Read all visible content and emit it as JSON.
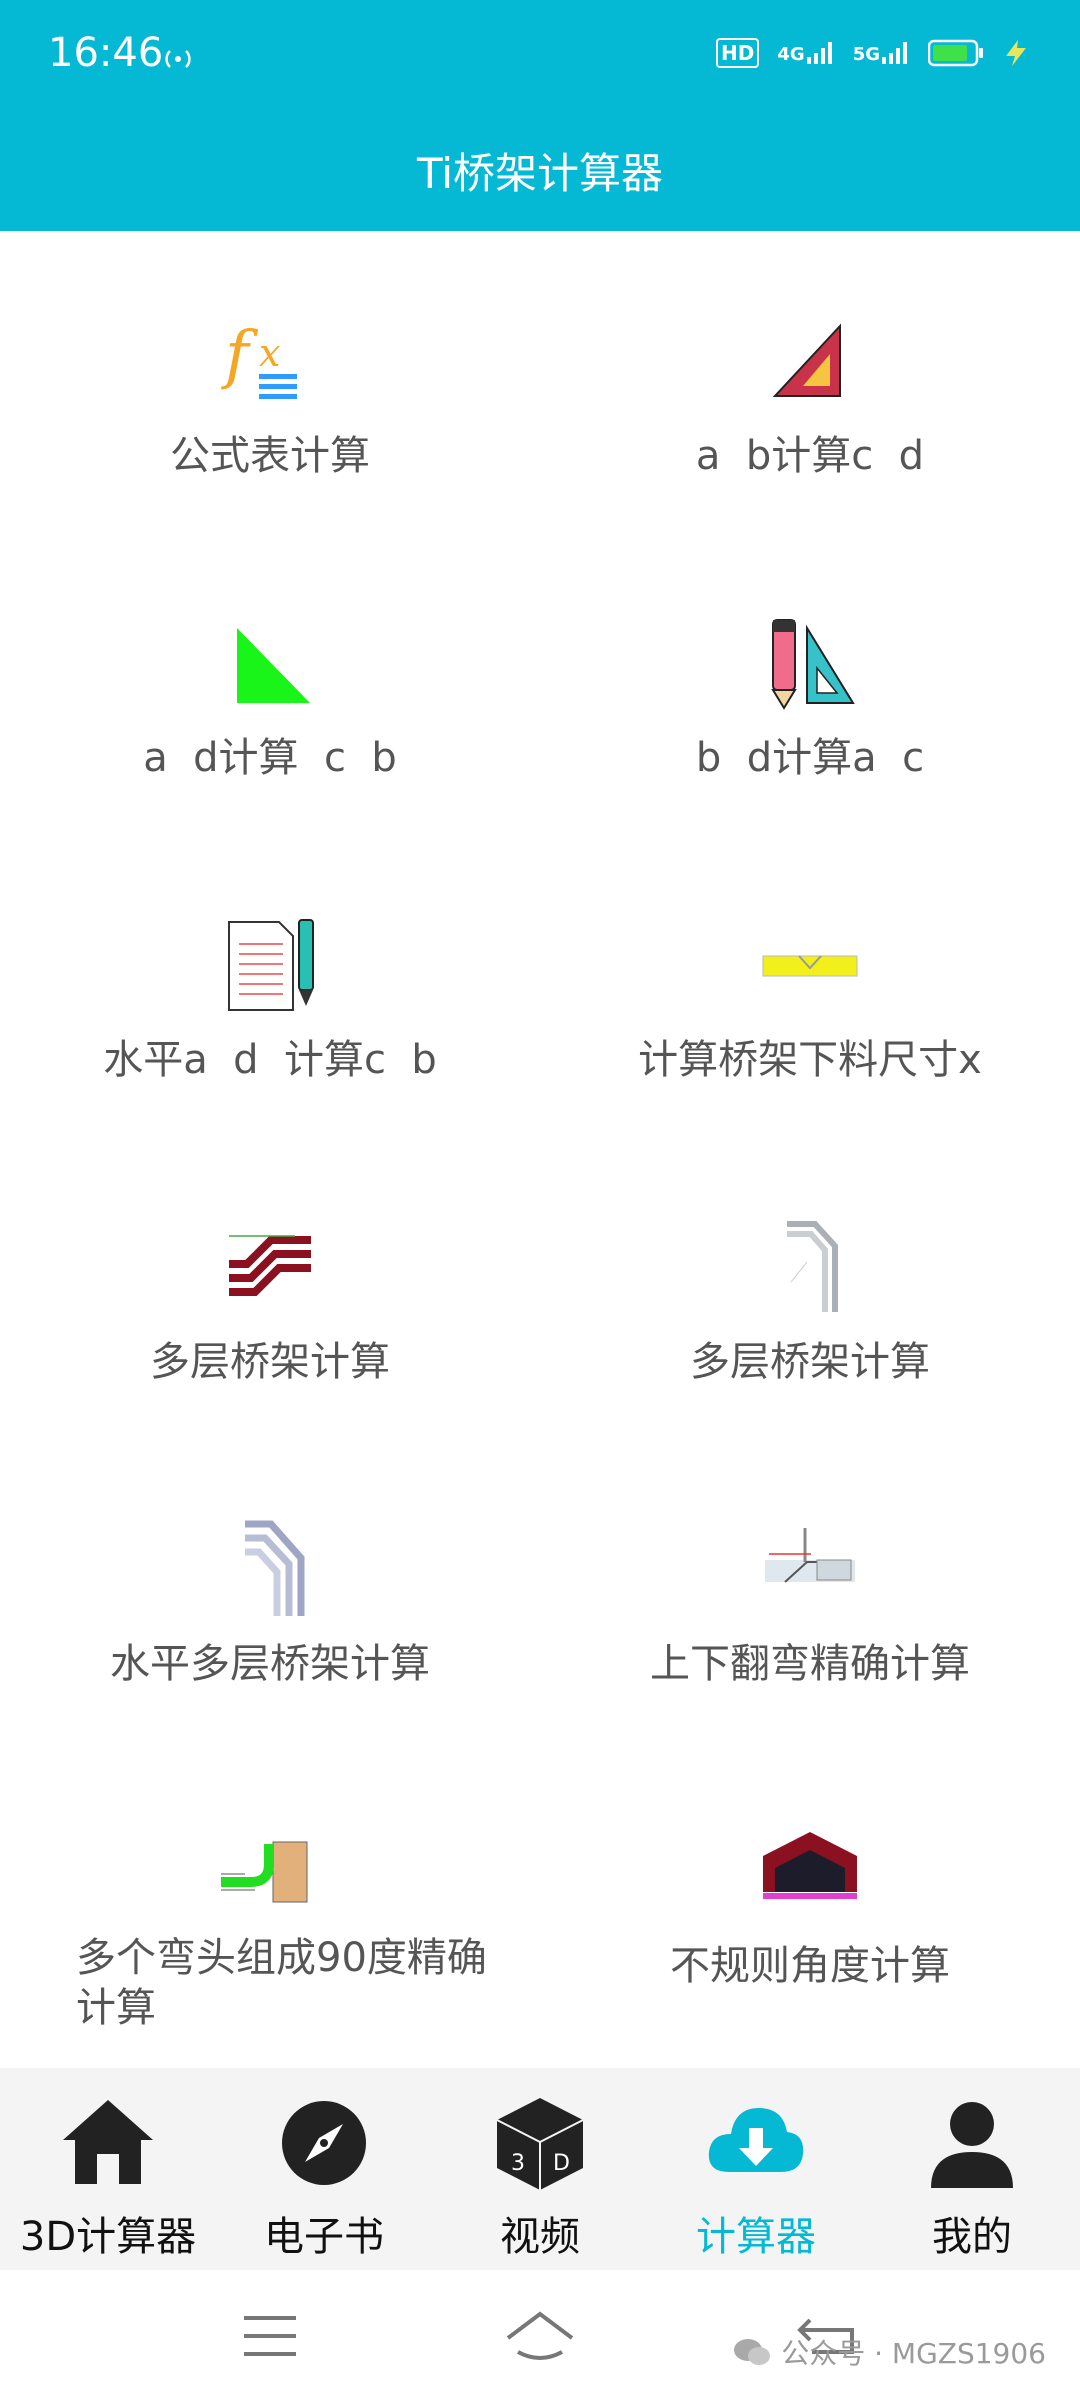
{
  "status": {
    "time": "16:46",
    "hd_label": "HD",
    "net1": "4G",
    "net2": "5G"
  },
  "app": {
    "title": "Ti桥架计算器"
  },
  "tiles": [
    {
      "label": "公式表计算",
      "icon": "formula-icon"
    },
    {
      "label": "a  b计算c  d",
      "icon": "set-square-icon"
    },
    {
      "label": "a  d计算  c  b",
      "icon": "green-triangle-icon"
    },
    {
      "label": "b  d计算a  c",
      "icon": "pencil-ruler-icon"
    },
    {
      "label": "水平a  d  计算c  b",
      "icon": "document-pen-icon"
    },
    {
      "label": "计算桥架下料尺寸x",
      "icon": "cable-tray-icon"
    },
    {
      "label": "多层桥架计算",
      "icon": "multilayer-tray-icon"
    },
    {
      "label": "多层桥架计算",
      "icon": "bend-tray-icon"
    },
    {
      "label": "水平多层桥架计算",
      "icon": "horizontal-bend-icon"
    },
    {
      "label": "上下翻弯精确计算",
      "icon": "updown-bend-icon"
    },
    {
      "label": "多个弯头组成90度精确计算",
      "icon": "elbow-90-icon"
    },
    {
      "label": "不规则角度计算",
      "icon": "irregular-angle-icon"
    }
  ],
  "bottom_nav": [
    {
      "label": "3D计算器",
      "icon": "home-icon"
    },
    {
      "label": "电子书",
      "icon": "compass-icon"
    },
    {
      "label": "视频",
      "icon": "cube-3d-icon"
    },
    {
      "label": "计算器",
      "icon": "cloud-download-icon",
      "active": true
    },
    {
      "label": "我的",
      "icon": "person-icon"
    }
  ],
  "watermark": "公众号 · MGZS1906",
  "colors": {
    "accent": "#05b9d5"
  }
}
